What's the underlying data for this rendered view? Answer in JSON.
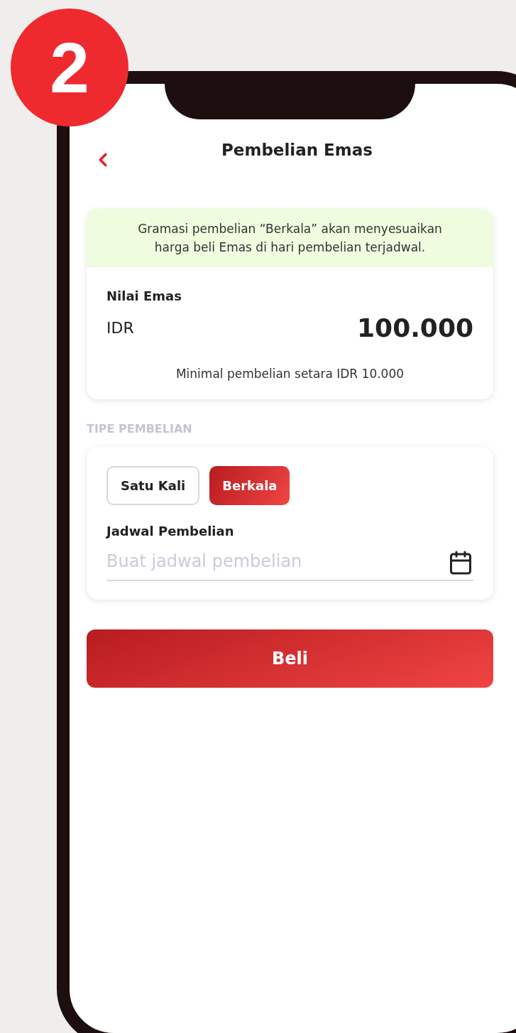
{
  "step_badge": "2",
  "header": {
    "title": "Pembelian Emas"
  },
  "info_card": {
    "notice": "Gramasi pembelian “Berkala” akan menyesuaikan harga beli Emas di hari pembelian terjadwal.",
    "label": "Nilai Emas",
    "currency": "IDR",
    "amount": "100.000",
    "note": "Minimal pembelian setara IDR 10.000"
  },
  "purchase_type": {
    "heading": "TIPE PEMBELIAN",
    "options": [
      {
        "label": "Satu Kali",
        "selected": false
      },
      {
        "label": "Berkala",
        "selected": true
      }
    ],
    "schedule_label": "Jadwal Pembelian",
    "schedule_field": {
      "placeholder": "Buat jadwal pembelian"
    }
  },
  "buy_button": "Beli"
}
